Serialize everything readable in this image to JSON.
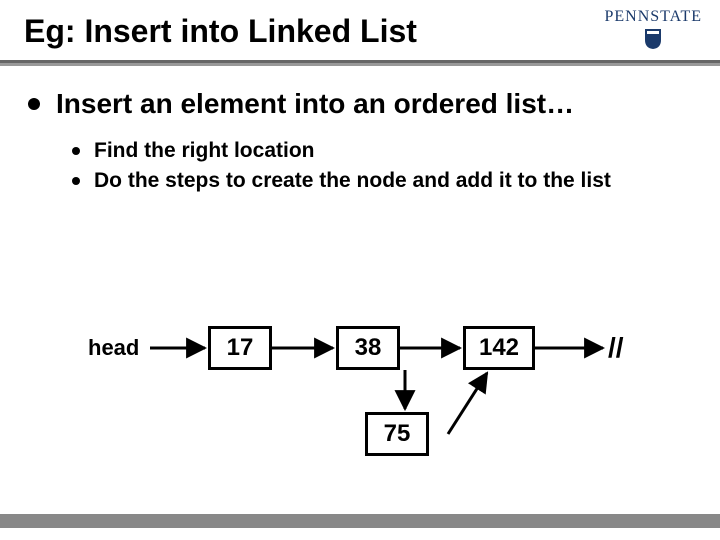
{
  "title": "Eg: Insert into Linked List",
  "logo": {
    "text": "PENNSTATE"
  },
  "bullets": {
    "main": "Insert an element into an ordered list…",
    "sub1": "Find the right location",
    "sub2": "Do the steps to create the node and add it to the list"
  },
  "diagram": {
    "head_label": "head",
    "node1": "17",
    "node2": "38",
    "node3": "142",
    "insert": "75",
    "terminator": "//"
  }
}
